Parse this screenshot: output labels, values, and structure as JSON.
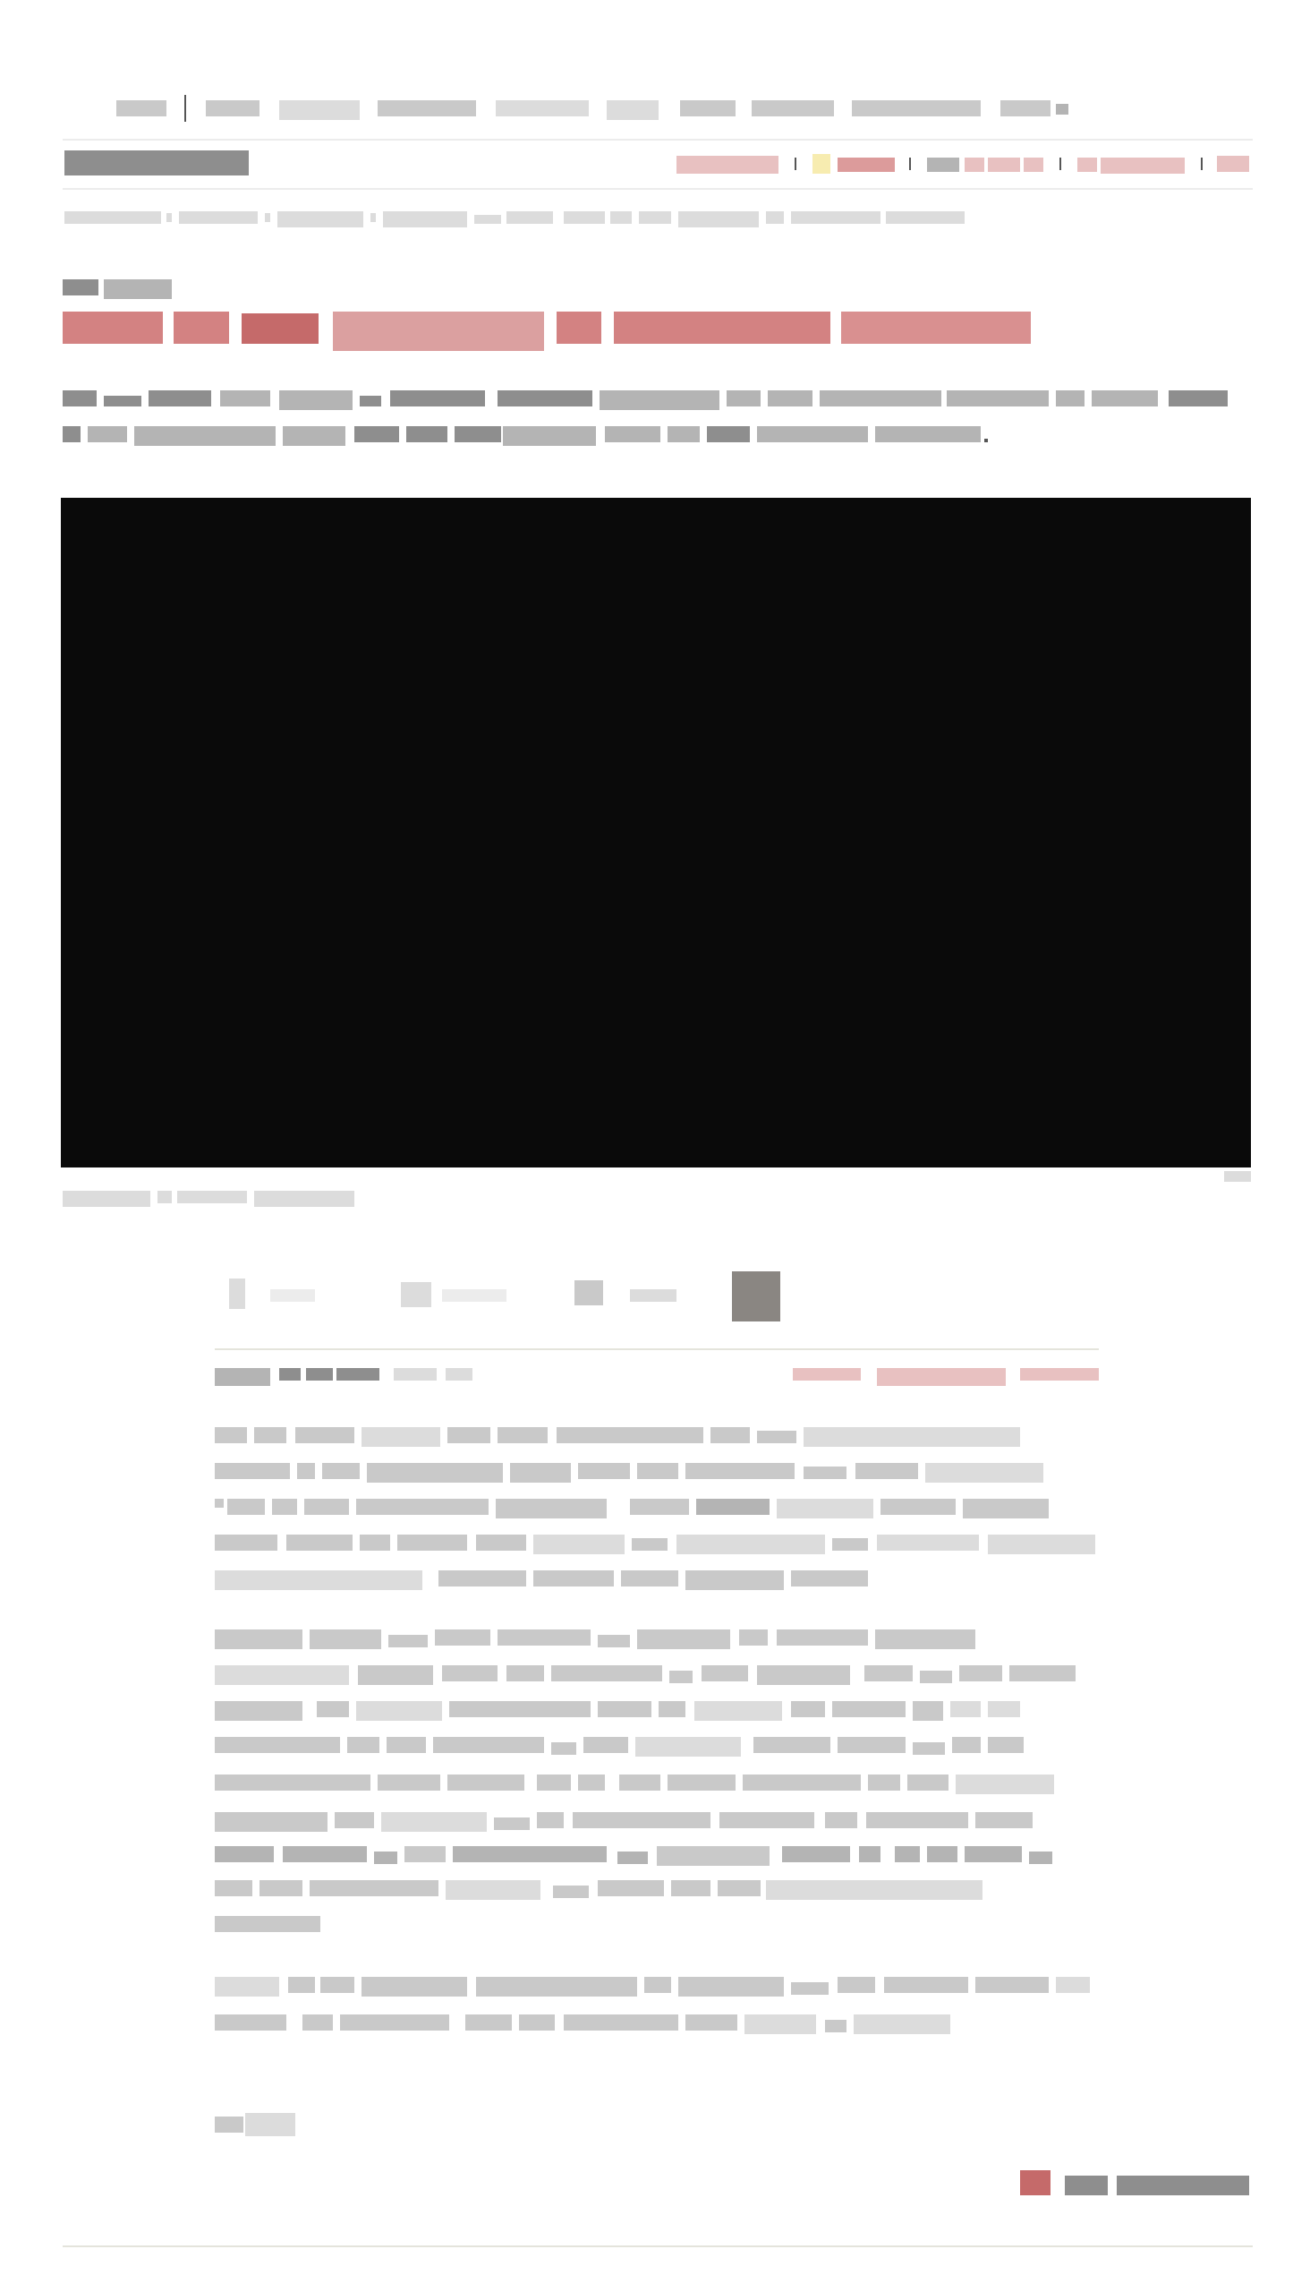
{
  "nav": {
    "items": [
      "",
      "",
      "",
      "",
      "",
      "",
      "",
      ""
    ]
  },
  "header": {
    "site_title": "",
    "links": [
      "",
      "",
      "",
      "",
      ""
    ]
  },
  "breadcrumb": {
    "text": ""
  },
  "article": {
    "kicker": "",
    "headline": "",
    "dek": ""
  },
  "media": {
    "caption": "",
    "credit": ""
  },
  "byline": {
    "author": "",
    "date": "",
    "links": [
      "",
      "",
      ""
    ]
  },
  "body": {
    "paragraphs": [
      "",
      "",
      ""
    ]
  },
  "footer": {
    "tag": "",
    "share_label": ""
  },
  "colors": {
    "headline": "#d38282",
    "link": "#e8c1c1",
    "text": "#b4b4b4",
    "video_bg": "#0a0a0a"
  },
  "icons": [
    "share-icon",
    "comment-icon",
    "bookmark-icon",
    "print-icon"
  ]
}
